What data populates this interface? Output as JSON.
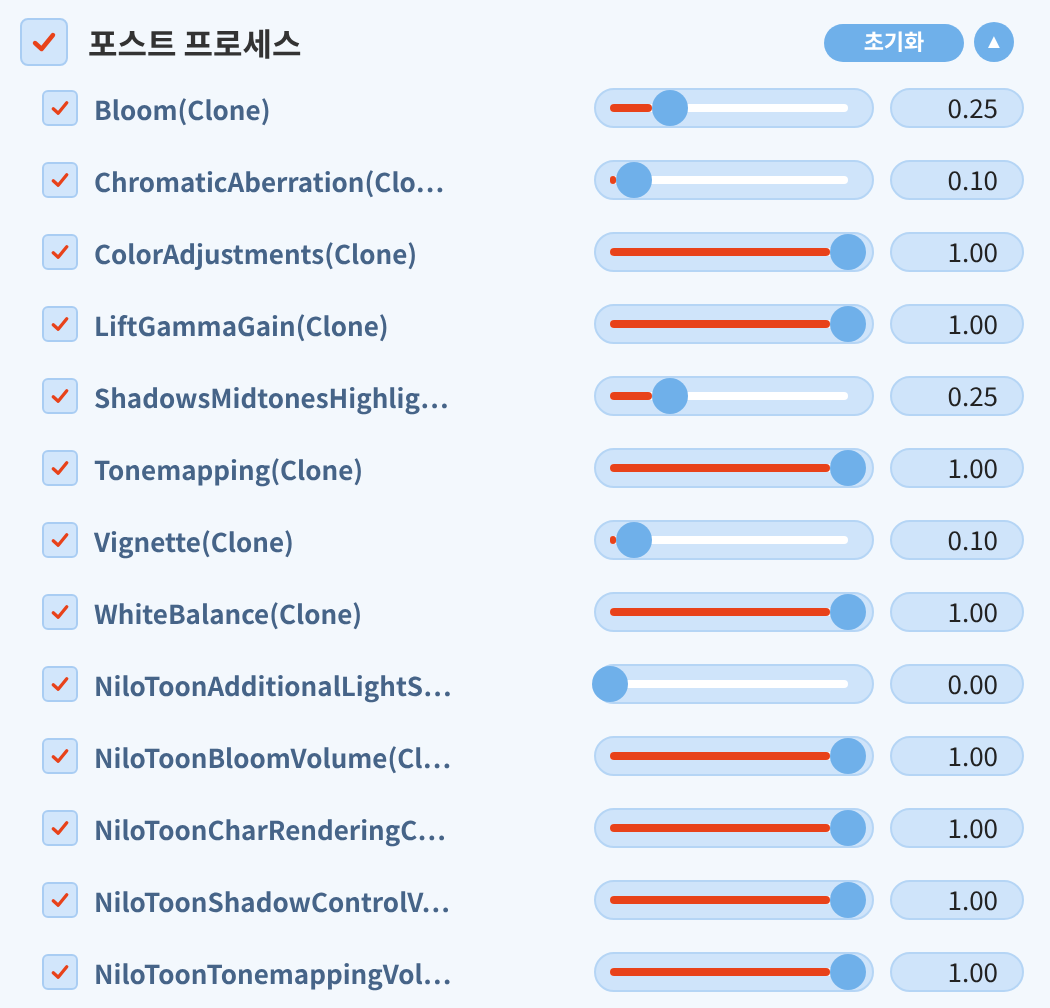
{
  "section": {
    "title": "포스트 프로세스",
    "checked": true,
    "reset_label": "초기화",
    "collapse_icon": "▲"
  },
  "effects": [
    {
      "name": "Bloom(Clone)",
      "checked": true,
      "level": 0.25,
      "reading": "0.25"
    },
    {
      "name": "ChromaticAberration(Clo…",
      "checked": true,
      "level": 0.1,
      "reading": "0.10"
    },
    {
      "name": "ColorAdjustments(Clone)",
      "checked": true,
      "level": 1,
      "reading": "1.00"
    },
    {
      "name": "LiftGammaGain(Clone)",
      "checked": true,
      "level": 1,
      "reading": "1.00"
    },
    {
      "name": "ShadowsMidtonesHighlig…",
      "checked": true,
      "level": 0.25,
      "reading": "0.25"
    },
    {
      "name": "Tonemapping(Clone)",
      "checked": true,
      "level": 1,
      "reading": "1.00"
    },
    {
      "name": "Vignette(Clone)",
      "checked": true,
      "level": 0.1,
      "reading": "0.10"
    },
    {
      "name": "WhiteBalance(Clone)",
      "checked": true,
      "level": 1,
      "reading": "1.00"
    },
    {
      "name": "NiloToonAdditionalLightS…",
      "checked": true,
      "level": 0,
      "reading": "0.00"
    },
    {
      "name": "NiloToonBloomVolume(Cl…",
      "checked": true,
      "level": 1,
      "reading": "1.00"
    },
    {
      "name": "NiloToonCharRenderingC…",
      "checked": true,
      "level": 1,
      "reading": "1.00"
    },
    {
      "name": "NiloToonShadowControlV…",
      "checked": true,
      "level": 1,
      "reading": "1.00"
    },
    {
      "name": "NiloToonTonemappingVol…",
      "checked": true,
      "level": 1,
      "reading": "1.00"
    }
  ]
}
